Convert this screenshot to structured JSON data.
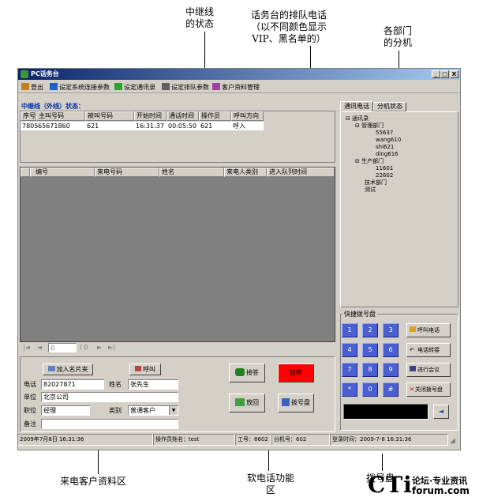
{
  "annotations": {
    "trunk_status": [
      "中继线",
      "的状态"
    ],
    "queue_calls": [
      "话务台的排队电话",
      "（以不同颜色显示",
      "VIP、黑名单的）"
    ],
    "extensions": [
      "各部门",
      "的分机"
    ],
    "caller_info_area": "来电客户资料区",
    "softphone_area": [
      "软电话功能",
      "区"
    ],
    "dialpad_area": "拨号盘"
  },
  "watermark": {
    "brand": "CTi",
    "line1": "论坛·专业资讯",
    "line2": "forum.com"
  },
  "window": {
    "title": "PC话务台",
    "min": "_",
    "max": "□",
    "close": "X"
  },
  "menu": [
    {
      "label": "登出",
      "icon": "logout-icon"
    },
    {
      "label": "设定系统连接参数",
      "icon": "network-icon"
    },
    {
      "label": "设定通讯录",
      "icon": "addressbook-icon"
    },
    {
      "label": "设定排队参数",
      "icon": "queue-icon"
    },
    {
      "label": "客户资料管理",
      "icon": "users-icon"
    }
  ],
  "trunk": {
    "title": "中继线（外线）状态：",
    "columns": [
      "序号",
      "主叫号码",
      "被叫号码",
      "开始时间",
      "通话时间",
      "操作员",
      "呼叫方向"
    ],
    "rows": [
      [
        "7805",
        "65671860",
        "621",
        "16:31:37",
        "00:05:50",
        "621",
        "呼入"
      ]
    ]
  },
  "queue": {
    "columns": [
      "编号",
      "来电号码",
      "姓名",
      "来电人类别",
      "进入队列时间"
    ]
  },
  "pager": {
    "current": "0",
    "total": "/ 0"
  },
  "tabs": [
    "通讯电话",
    "分机状态"
  ],
  "tree": {
    "root": "通讯录",
    "groups": [
      {
        "name": "管理部门",
        "items": [
          "55637",
          "wang610",
          "shi621",
          "ding616"
        ]
      },
      {
        "name": "生产部门",
        "items": [
          "11601",
          "22602"
        ]
      },
      {
        "name": "技术部门",
        "items": []
      },
      {
        "name": "测试",
        "items": []
      }
    ]
  },
  "caller": {
    "add_card": "加入名片夹",
    "call": "呼叫",
    "phone_label": "电话",
    "phone": "82027871",
    "name_label": "姓名",
    "name": "张先生",
    "company_label": "单位",
    "company": "北京公司",
    "title_label": "职位",
    "title": "经理",
    "type_label": "类别",
    "type": "普通客户",
    "note_label": "备注",
    "note": ""
  },
  "softphone": {
    "answer": "接答",
    "hangup": "挂断",
    "playback": "放回",
    "dialpad": "拨号盘"
  },
  "dialpad": {
    "title": "快捷拨号盘",
    "keys": [
      "1",
      "2",
      "3",
      "4",
      "5",
      "6",
      "7",
      "8",
      "9",
      "*",
      "0",
      "#"
    ],
    "call": "呼叫电话",
    "transfer": "电话转接",
    "conference": "进行会议",
    "close": "关闭拨号盘",
    "back": "◄"
  },
  "status": {
    "date": "2009年7月8日  16:31:36",
    "operator": "操作员姓名：test",
    "job_no": "工号：8602",
    "ext": "分机号：602",
    "login": "登录时间：2009-7-8 16:31:36"
  },
  "colors": {
    "accent": "#0a246a",
    "grid_bg": "#808080",
    "key_blue": "#4a5fd0",
    "hangup_red": "#ff0000"
  }
}
